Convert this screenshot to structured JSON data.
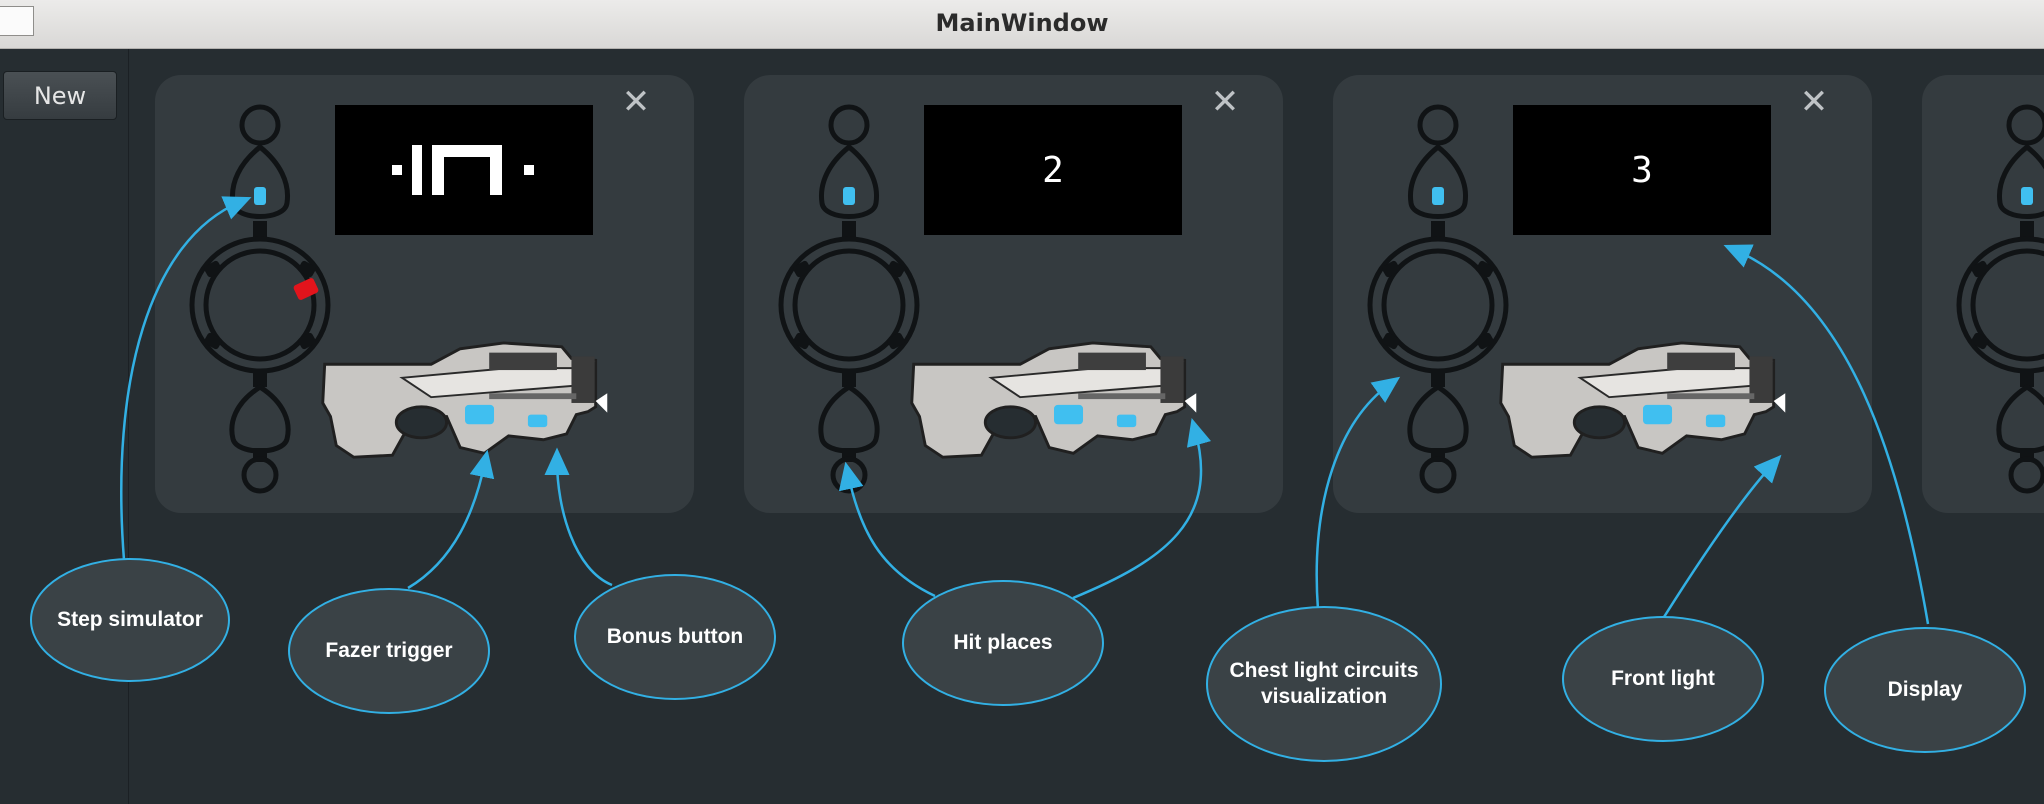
{
  "window": {
    "title": "MainWindow"
  },
  "toolbar": {
    "new_label": "New"
  },
  "players": [
    {
      "display_text": ""
    },
    {
      "display_text": "2"
    },
    {
      "display_text": "3"
    }
  ],
  "close_symbol": "✕",
  "callouts": {
    "step_simulator": "Step simulator",
    "fazer_trigger": "Fazer trigger",
    "bonus_button": "Bonus button",
    "hit_places": "Hit places",
    "chest_light": "Chest light circuits visualization",
    "front_light": "Front light",
    "display": "Display"
  },
  "colors": {
    "accent": "#32b0e4",
    "button_light": "#40bff0",
    "hit_active": "#e2141c"
  }
}
